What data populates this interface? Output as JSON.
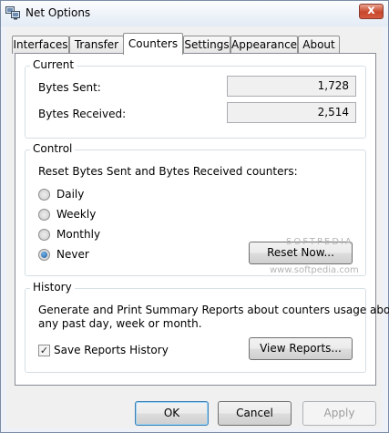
{
  "window": {
    "title": "Net Options",
    "close_glyph": "x"
  },
  "tabs": [
    {
      "label": "Interfaces",
      "active": false
    },
    {
      "label": "Transfer",
      "active": false
    },
    {
      "label": "Counters",
      "active": true
    },
    {
      "label": "Settings",
      "active": false
    },
    {
      "label": "Appearance",
      "active": false
    },
    {
      "label": "About",
      "active": false
    }
  ],
  "current": {
    "title": "Current",
    "bytes_sent_label": "Bytes Sent:",
    "bytes_sent_value": "1,728",
    "bytes_received_label": "Bytes Received:",
    "bytes_received_value": "2,514"
  },
  "control": {
    "title": "Control",
    "description": "Reset Bytes Sent and Bytes Received counters:",
    "options": [
      {
        "label": "Daily",
        "checked": false
      },
      {
        "label": "Weekly",
        "checked": false
      },
      {
        "label": "Monthly",
        "checked": false
      },
      {
        "label": "Never",
        "checked": true
      }
    ],
    "reset_button": "Reset Now..."
  },
  "history": {
    "title": "History",
    "description_line1": "Generate and Print Summary Reports about counters usage about",
    "description_line2": "any past day, week or month.",
    "save_label": "Save Reports History",
    "save_checked": true,
    "view_button": "View Reports..."
  },
  "footer": {
    "ok": "OK",
    "cancel": "Cancel",
    "apply": "Apply"
  },
  "watermark": {
    "brand": "SOFTPEDIA",
    "url": "www.softpedia.com"
  },
  "colors": {
    "close_red": "#c8462b",
    "default_button_border": "#3c7fb1",
    "radio_blue": "#1e5a99"
  }
}
